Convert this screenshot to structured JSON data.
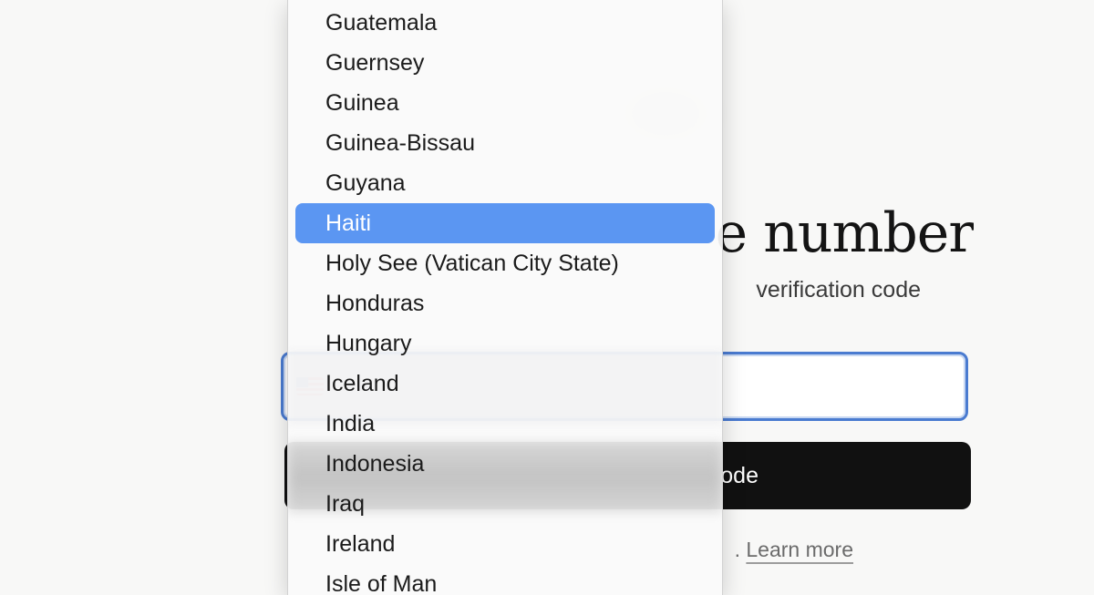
{
  "page": {
    "title": "e number",
    "subtitle": "verification code"
  },
  "phone_input": {
    "placeholder": ""
  },
  "send_button": {
    "label": "ode"
  },
  "disclaimer": {
    "text": ".",
    "link_label": "Learn more"
  },
  "country_dropdown": {
    "selected": "Haiti",
    "options": [
      "Guatemala",
      "Guernsey",
      "Guinea",
      "Guinea-Bissau",
      "Guyana",
      "Haiti",
      "Holy See (Vatican City State)",
      "Honduras",
      "Hungary",
      "Iceland",
      "India",
      "Indonesia",
      "Iraq",
      "Ireland",
      "Isle of Man"
    ]
  },
  "colors": {
    "background": "#f8f8f7",
    "selection": "#5b96f2",
    "field_focus_border": "#4a7bd0",
    "button": "#111111"
  }
}
